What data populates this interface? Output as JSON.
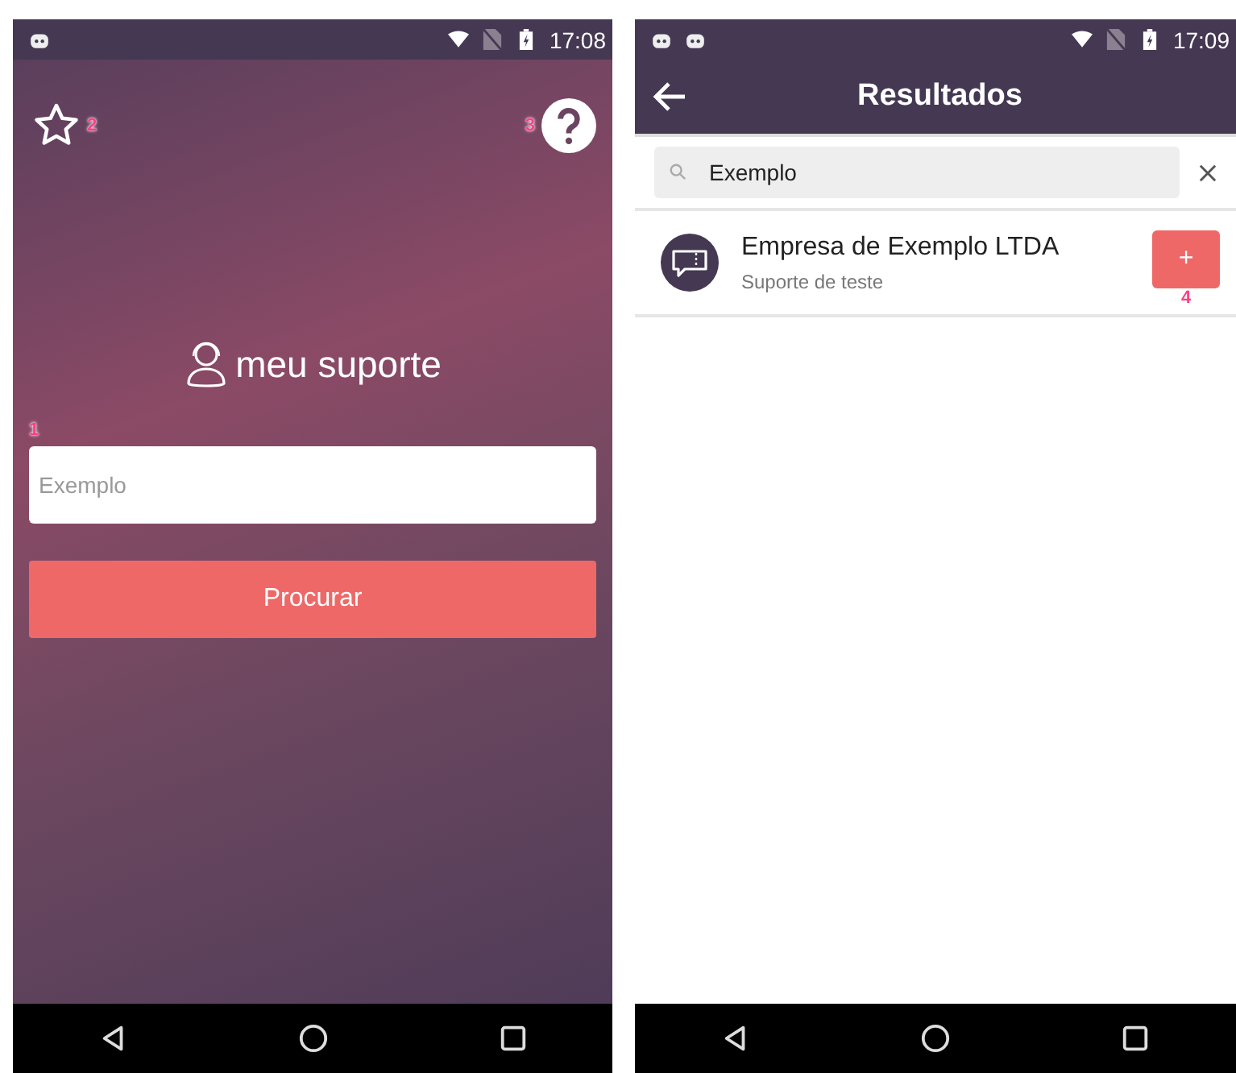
{
  "search_screen": {
    "status_bar": {
      "time": "17:08"
    },
    "favorites_marker": "2",
    "help_marker": "3",
    "logo_text": "meu suporte",
    "field_marker": "1",
    "search_field": {
      "placeholder": "Exemplo"
    },
    "search_button": "Procurar"
  },
  "results_screen": {
    "status_bar": {
      "time": "17:09"
    },
    "title": "Resultados",
    "search_field": {
      "value": "Exemplo"
    },
    "results": [
      {
        "name": "Empresa de Exemplo LTDA",
        "subtitle": "Suporte de teste",
        "add_label": "+",
        "marker": "4"
      }
    ]
  }
}
